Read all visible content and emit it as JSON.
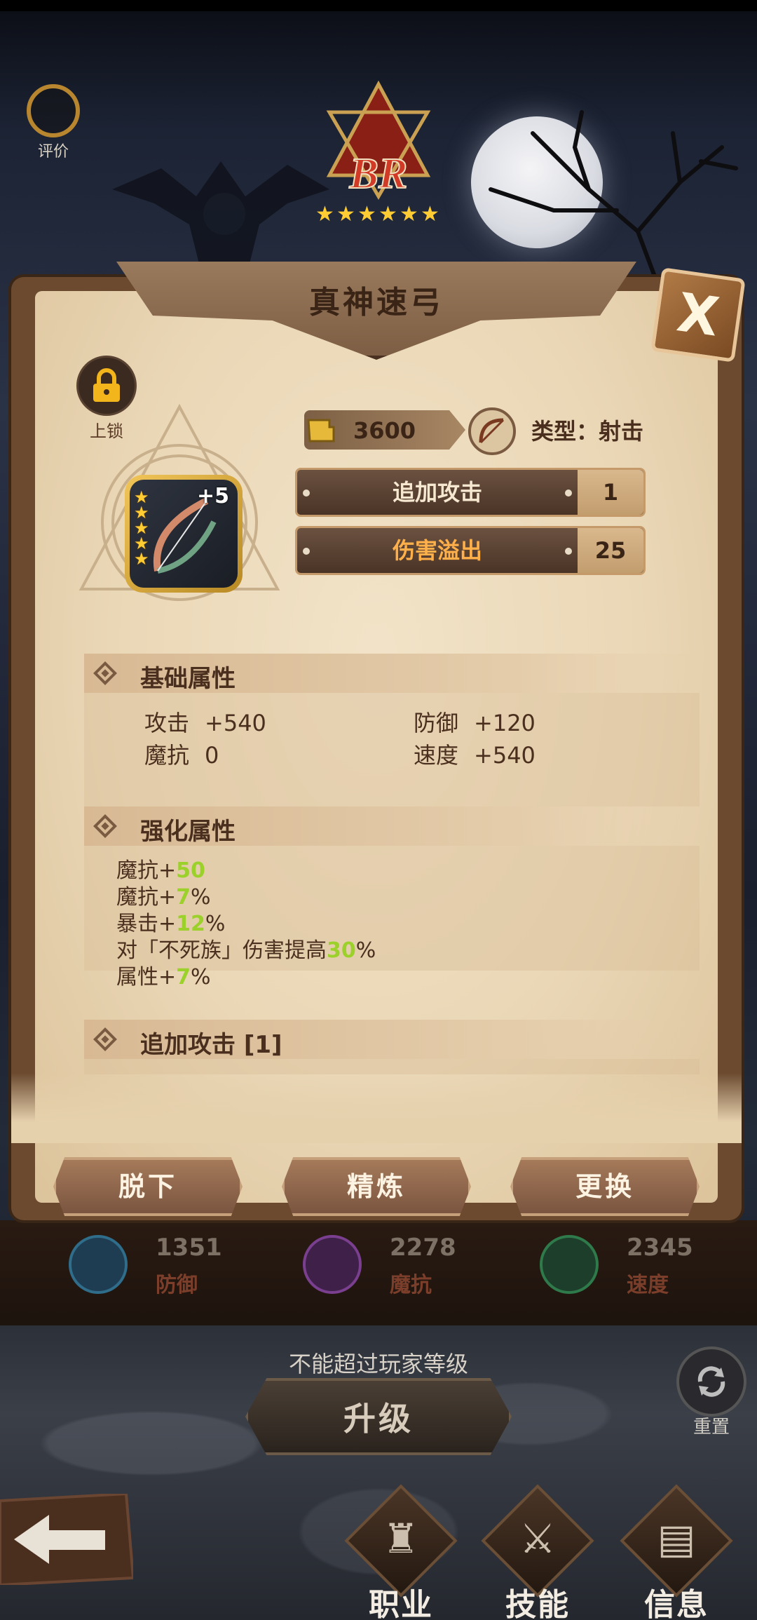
{
  "rating_label": "评价",
  "rank": {
    "label": "BR",
    "stars": 6
  },
  "panel": {
    "title": "真神速弓",
    "close_glyph": "X",
    "lock_label": "上锁",
    "item": {
      "plus": "+5",
      "stars": 5
    },
    "power": "3600",
    "type_label": "类型：射击",
    "options": [
      {
        "name": "追加攻击",
        "value": "1",
        "color": "#f5e7d0"
      },
      {
        "name": "伤害溢出",
        "value": "25",
        "color": "#ffb04a"
      }
    ],
    "base_section": {
      "title": "基础属性",
      "attrs": [
        {
          "name": "攻击",
          "value": "+540"
        },
        {
          "name": "防御",
          "value": "+120"
        },
        {
          "name": "魔抗",
          "value": "0"
        },
        {
          "name": "速度",
          "value": "+540"
        }
      ]
    },
    "enhance_section": {
      "title": "强化属性",
      "lines": [
        {
          "prefix": "魔抗+",
          "num": "50",
          "suffix": ""
        },
        {
          "prefix": "魔抗+",
          "num": "7",
          "suffix": "%"
        },
        {
          "prefix": "暴击+",
          "num": "12",
          "suffix": "%"
        },
        {
          "prefix": "对「不死族」伤害提高",
          "num": "30",
          "suffix": "%"
        },
        {
          "prefix": "属性+",
          "num": "7",
          "suffix": "%"
        }
      ]
    },
    "extra_section": {
      "title": "追加攻击 [1]"
    },
    "actions": [
      "脱下",
      "精炼",
      "更换"
    ]
  },
  "stats": [
    {
      "value": "1351",
      "label": "防御",
      "icon": "shield-icon",
      "color": "#2f6d8a"
    },
    {
      "value": "2278",
      "label": "魔抗",
      "icon": "magic-shield-icon",
      "color": "#7a3f8f"
    },
    {
      "value": "2345",
      "label": "速度",
      "icon": "boot-icon",
      "color": "#2f7a4a"
    }
  ],
  "level": {
    "limit_text": "不能超过玩家等级",
    "button": "升级",
    "reset_label": "重置"
  },
  "nav": [
    {
      "label": "职业",
      "glyph": "♜",
      "icon": "class-icon"
    },
    {
      "label": "技能",
      "glyph": "⚔",
      "icon": "skill-icon"
    },
    {
      "label": "信息",
      "glyph": "▤",
      "icon": "info-icon"
    }
  ]
}
